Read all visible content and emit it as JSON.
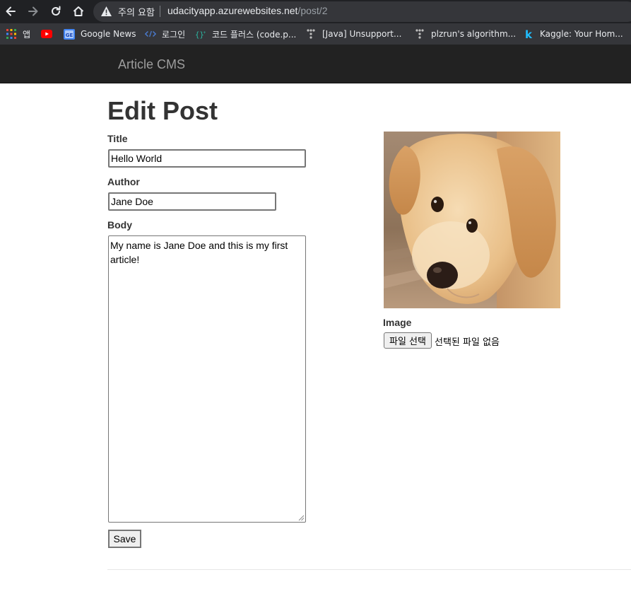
{
  "browser": {
    "security_label": "주의 요함",
    "url_host": "udacityapp.azurewebsites.net",
    "url_path": "/post/2",
    "bookmarks": [
      {
        "label": "앱",
        "icon": "apps-grid-icon"
      },
      {
        "label": "",
        "icon": "youtube-icon"
      },
      {
        "label": "Google News",
        "icon": "google-news-icon"
      },
      {
        "label": "로그인",
        "icon": "code-brackets-icon"
      },
      {
        "label": "코드 플러스 (code.p...",
        "icon": "code-plus-icon"
      },
      {
        "label": "[Java] Unsupport...",
        "icon": "tree-icon"
      },
      {
        "label": "plzrun's algorithm...",
        "icon": "tree-icon"
      },
      {
        "label": "Kaggle: Your Hom...",
        "icon": "kaggle-icon"
      }
    ]
  },
  "site": {
    "brand": "Article CMS"
  },
  "form": {
    "heading": "Edit Post",
    "title_label": "Title",
    "title_value": "Hello World",
    "author_label": "Author",
    "author_value": "Jane Doe",
    "body_label": "Body",
    "body_value": "My name is Jane Doe and this is my first article!",
    "save_label": "Save",
    "image_label": "Image",
    "file_button_label": "파일 선택",
    "file_status": "선택된 파일 없음"
  },
  "colors": {
    "navbar_bg": "#222222",
    "brand_text": "#9d9d9d",
    "heading_text": "#333333"
  }
}
